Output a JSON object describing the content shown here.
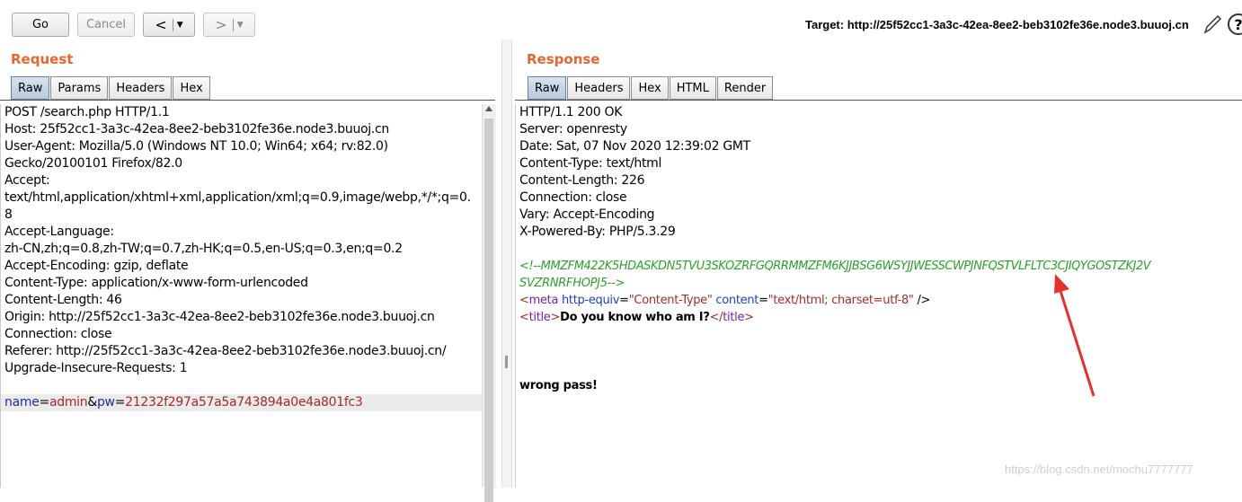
{
  "toolbar": {
    "go_label": "Go",
    "cancel_label": "Cancel",
    "back_label": "<",
    "forward_label": ">",
    "target_text": "Target: http://25f52cc1-3a3c-42ea-8ee2-beb3102fe36e.node3.buuoj.cn",
    "help_label": "?"
  },
  "request": {
    "title": "Request",
    "tabs": [
      "Raw",
      "Params",
      "Headers",
      "Hex"
    ],
    "lines": [
      "POST /search.php HTTP/1.1",
      "Host: 25f52cc1-3a3c-42ea-8ee2-beb3102fe36e.node3.buuoj.cn",
      "User-Agent: Mozilla/5.0 (Windows NT 10.0; Win64; x64; rv:82.0)",
      "Gecko/20100101 Firefox/82.0",
      "Accept:",
      "text/html,application/xhtml+xml,application/xml;q=0.9,image/webp,*/*;q=0.",
      "8",
      "Accept-Language:",
      "zh-CN,zh;q=0.8,zh-TW;q=0.7,zh-HK;q=0.5,en-US;q=0.3,en;q=0.2",
      "Accept-Encoding: gzip, deflate",
      "Content-Type: application/x-www-form-urlencoded",
      "Content-Length: 46",
      "Origin: http://25f52cc1-3a3c-42ea-8ee2-beb3102fe36e.node3.buuoj.cn",
      "Connection: close",
      "Referer: http://25f52cc1-3a3c-42ea-8ee2-beb3102fe36e.node3.buuoj.cn/",
      "Upgrade-Insecure-Requests: 1"
    ],
    "body": {
      "p1_name": "name",
      "eq": "=",
      "p1_value": "admin",
      "amp": "&",
      "p2_name": "pw",
      "p2_value": "21232f297a57a5a743894a0e4a801fc3"
    }
  },
  "response": {
    "title": "Response",
    "tabs": [
      "Raw",
      "Headers",
      "Hex",
      "HTML",
      "Render"
    ],
    "headers": [
      "HTTP/1.1 200 OK",
      "Server: openresty",
      "Date: Sat, 07 Nov 2020 12:39:02 GMT",
      "Content-Type: text/html",
      "Content-Length: 226",
      "Connection: close",
      "Vary: Accept-Encoding",
      "X-Powered-By: PHP/5.3.29"
    ],
    "comment_line1": "<!--MMZFM422K5HDASKDN5TVU3SKOZRFGQRRMMZFM6KJJBSG6WSYJJWESSCWPJNFQSTVLFLTC3CJIQYGOSTZKJ2V",
    "comment_line2": "SVZRNRFHOPJ5-->",
    "meta": {
      "open": "<",
      "tag": "meta",
      "attr1": " http-equiv",
      "eq": "=",
      "val1": "\"Content-Type\"",
      "attr2": " content",
      "val2": "\"text/html; charset=utf-8\"",
      "close": " />"
    },
    "title_line": {
      "open": "<",
      "tag": "title",
      "gt": ">",
      "text": "Do you know who am I?",
      "close_open": "</",
      "close_gt": ">"
    },
    "body_text": "wrong pass!"
  },
  "watermark": "https://blog.csdn.net/mochu7777777",
  "colors": {
    "section_title": "#e8662e",
    "comment": "#2aa02a",
    "arrow": "#e53030",
    "active_tab": "#c3d3e4"
  }
}
